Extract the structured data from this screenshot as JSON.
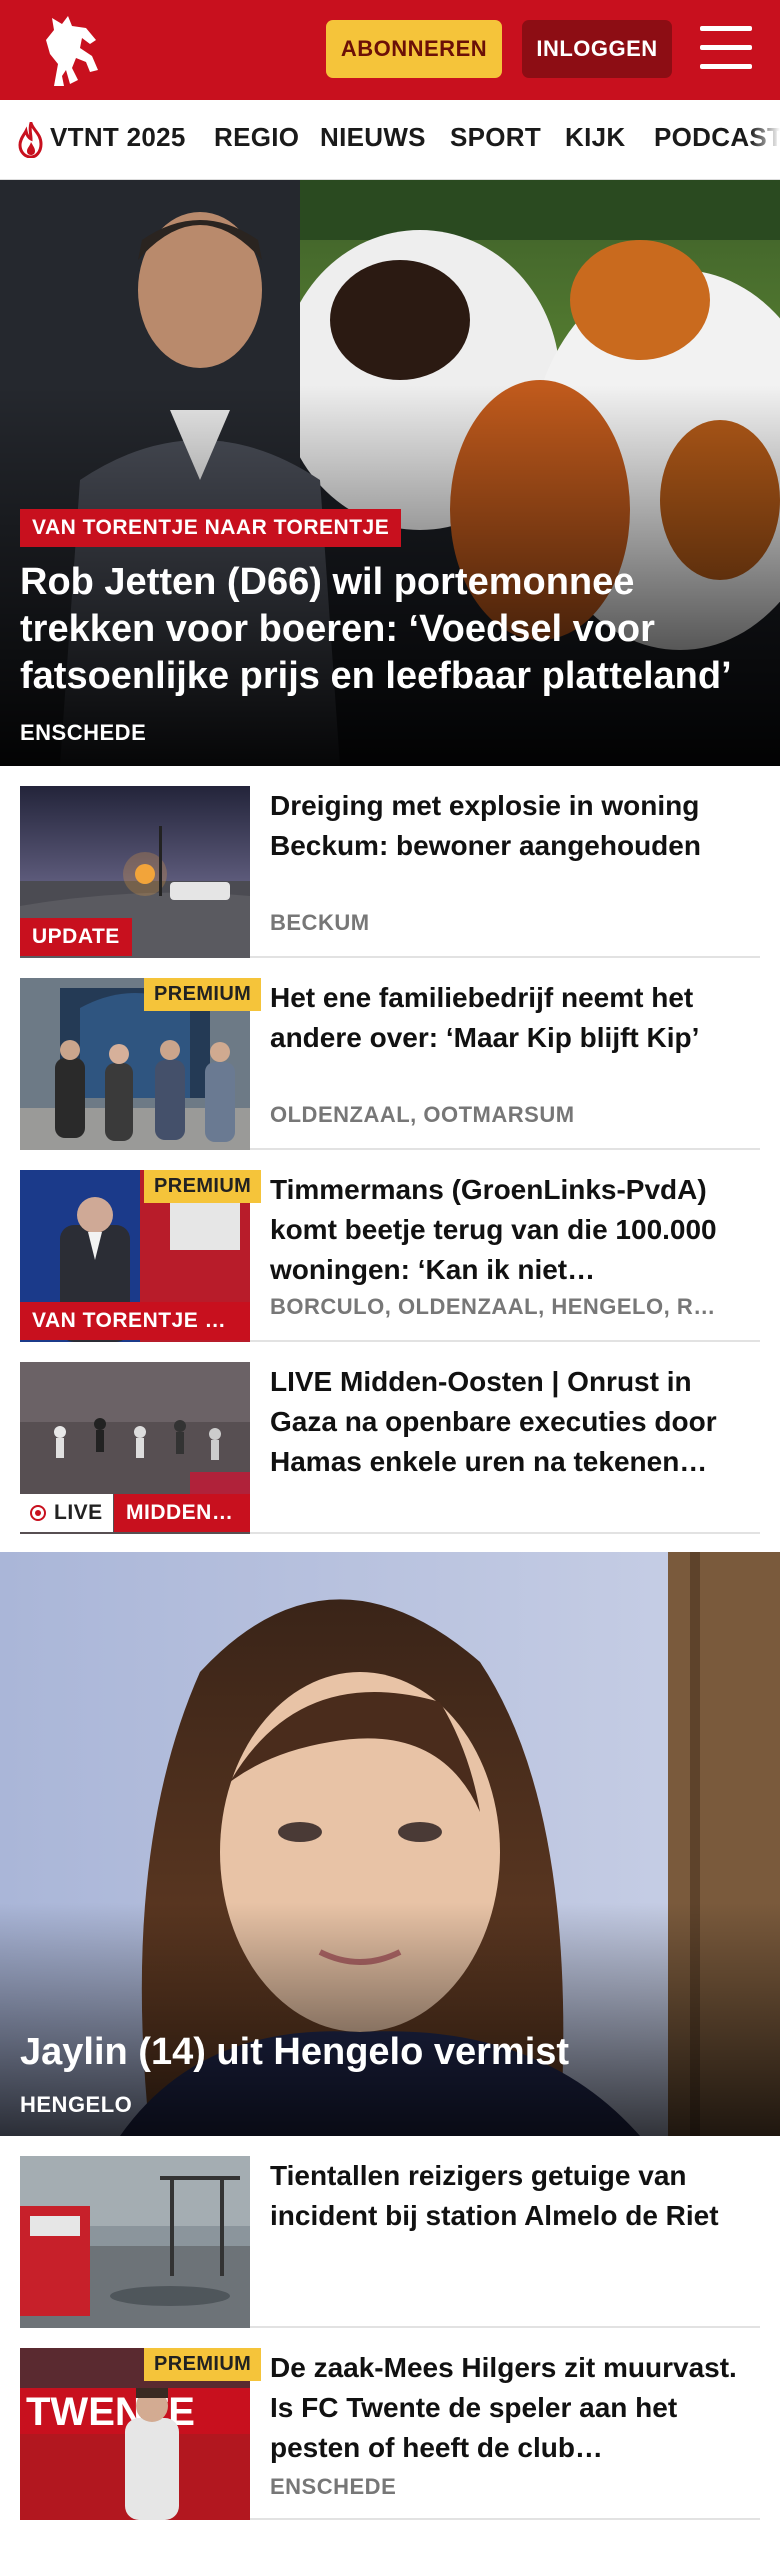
{
  "header": {
    "logo_name": "Tubantia logo",
    "subscribe_label": "ABONNEREN",
    "login_label": "INLOGGEN",
    "menu_icon": "hamburger-menu-icon",
    "colors": {
      "brand_red": "#c8101e",
      "subscribe_yellow": "#f5c43a",
      "login_dark_red": "#8d0d14"
    }
  },
  "nav": {
    "items": [
      "VTNT 2025",
      "REGIO",
      "NIEUWS",
      "SPORT",
      "KIJK",
      "PODCAST"
    ],
    "first_icon": "flame-icon"
  },
  "hero_main": {
    "tag": "VAN TORENTJE NAAR TORENTJE",
    "title": "Rob Jetten (D66) wil portemonnee trekken voor boeren: ‘Voedsel voor fatsoenlijke prijs en leefbaar platteland’",
    "location": "ENSCHEDE"
  },
  "articles_top": [
    {
      "title": "Dreiging met explosie in woning Beckum: bewoner aangehouden",
      "location": "BECKUM",
      "badge": "UPDATE"
    },
    {
      "title": "Het ene familiebedrijf neemt het andere over: ‘Maar Kip blijft Kip’",
      "location": "OLDENZAAL, OOTMARSUM",
      "premium": "PREMIUM"
    },
    {
      "title": "Timmermans (GroenLinks-PvdA) komt beetje terug van die 100.000 woningen: ‘Kan ik niet…",
      "location": "BORCULO, OLDENZAAL, HENGELO, R…",
      "premium": "PREMIUM",
      "badge": "VAN TORENTJE N…"
    },
    {
      "title": "LIVE Midden-Oosten | Onrust in Gaza na openbare executies door Hamas enkele uren na tekenen…",
      "live": "LIVE",
      "badge": "MIDDEN-…"
    }
  ],
  "hero_second": {
    "title": "Jaylin (14) uit Hengelo vermist",
    "location": "HENGELO"
  },
  "articles_bottom": [
    {
      "title": "Tientallen reizigers getuige van incident bij station Almelo de Riet"
    },
    {
      "title": "De zaak-Mees Hilgers zit muurvast. Is FC Twente de speler aan het pesten of heeft de club…",
      "location": "ENSCHEDE",
      "premium": "PREMIUM",
      "banner_text": "TWENTE"
    }
  ]
}
